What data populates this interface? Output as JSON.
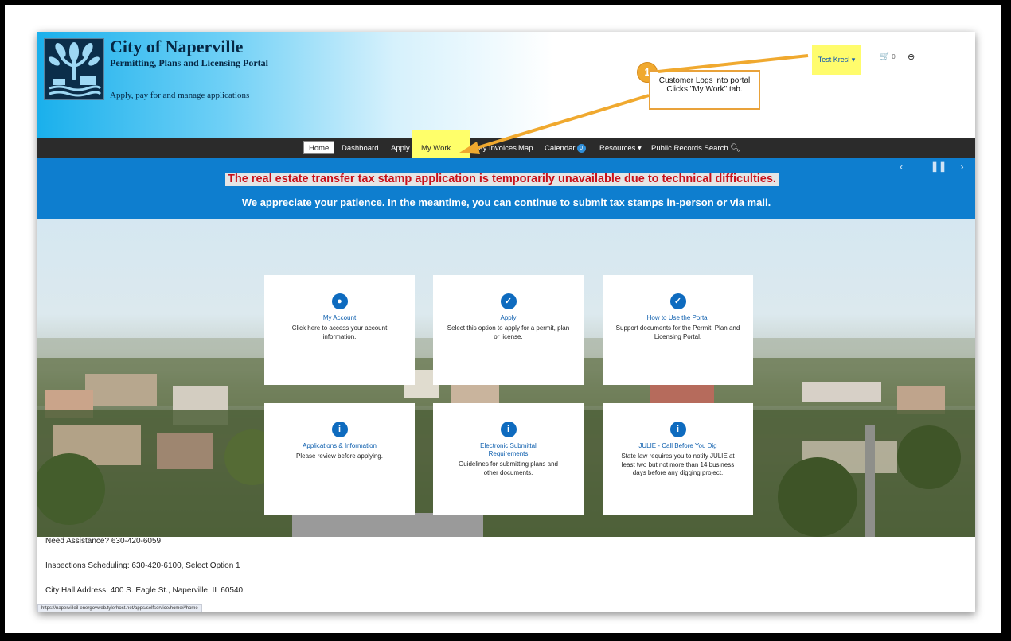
{
  "header": {
    "org_name": "City of Naperville",
    "org_subtitle": "Permitting, Plans and Licensing Portal",
    "tagline": "Apply, pay for and manage applications",
    "user_name": "Test Kresl ▾",
    "cart_count": "0"
  },
  "annotation": {
    "step_number": "1",
    "text": "Customer Logs into portal Clicks \"My Work\" tab."
  },
  "nav": {
    "home": "Home",
    "dashboard": "Dashboard",
    "apply": "Apply",
    "my_work": "My Work",
    "pay_invoices": "Pay Invoices",
    "map": "Map",
    "calendar": "Calendar",
    "calendar_badge": "0",
    "resources": "Resources ▾",
    "public_records": "Public Records Search"
  },
  "banner": {
    "line1": "The real estate transfer tax stamp application is temporarily unavailable due to technical difficulties.",
    "line2": "We appreciate your patience.  In the meantime, you can continue to submit tax stamps in-person or via mail."
  },
  "cards": [
    {
      "title": "My Account",
      "desc": "Click here to access your account information.",
      "icon": "user-icon"
    },
    {
      "title": "Apply",
      "desc": "Select this option to apply for a permit, plan or license.",
      "icon": "clipboard-icon"
    },
    {
      "title": "How to Use the Portal",
      "desc": "Support documents for the Permit, Plan and Licensing Portal.",
      "icon": "clipboard-icon"
    },
    {
      "title": "Applications & Information",
      "desc": "Please review before applying.",
      "icon": "info-icon"
    },
    {
      "title": "Electronic Submittal Requirements",
      "desc": "Guidelines for submitting plans and other documents.",
      "icon": "info-icon"
    },
    {
      "title": "JULIE - Call Before You Dig",
      "desc": "State law requires you to notify JULIE at least two but not more than 14 business days before any digging project.",
      "icon": "info-icon"
    }
  ],
  "footer": {
    "assistance": "Need Assistance? 630-420-6059",
    "inspections": "Inspections Scheduling: 630-420-6100, Select Option 1",
    "address": "City Hall Address: 400 S. Eagle St., Naperville, IL 60540",
    "status_url": "https://napervilleil-energovweb.tylerhost.net/apps/selfservice/home#/home"
  },
  "colors": {
    "nav_bg": "#2b2b2b",
    "banner_bg": "#0e7ecf",
    "banner_alert": "#c8101a",
    "highlight": "#ffff6a",
    "annotation": "#f0a92f",
    "link": "#0e5fae"
  }
}
